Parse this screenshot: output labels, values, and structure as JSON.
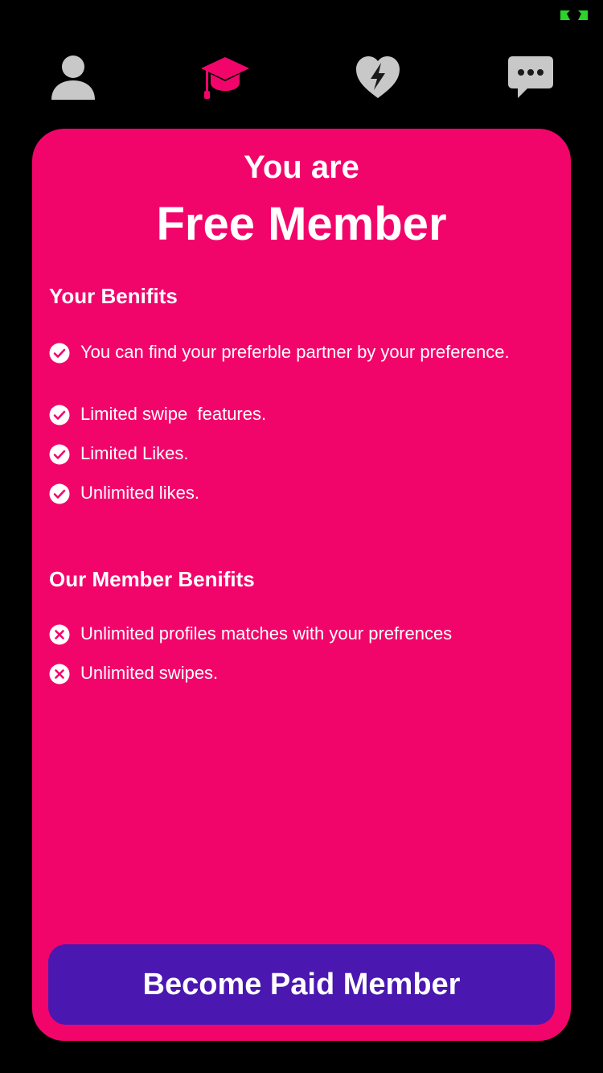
{
  "colors": {
    "background": "#000000",
    "card": "#f2056b",
    "cta": "#4a17b0",
    "tab_active": "#f2056b",
    "tab_inactive": "#c8c8c8",
    "status_indicator": "#2bd42b"
  },
  "tabs": [
    {
      "icon": "person-icon",
      "active": false
    },
    {
      "icon": "graduation-cap-icon",
      "active": true
    },
    {
      "icon": "heart-bolt-icon",
      "active": false
    },
    {
      "icon": "chat-bubble-icon",
      "active": false
    }
  ],
  "membership": {
    "intro": "You are",
    "status": "Free Member"
  },
  "your_benefits": {
    "title": "Your Benifits",
    "items": [
      {
        "text": "You can find your preferble partner by your preference.",
        "icon": "check-circle-icon"
      },
      {
        "text": "Limited swipe  features.",
        "icon": "check-circle-icon"
      },
      {
        "text": "Limited Likes.",
        "icon": "check-circle-icon"
      },
      {
        "text": "Unlimited likes.",
        "icon": "check-circle-icon"
      }
    ]
  },
  "member_benefits": {
    "title": "Our Member Benifits",
    "items": [
      {
        "text": "Unlimited profiles matches with your prefrences",
        "icon": "x-circle-icon"
      },
      {
        "text": "Unlimited swipes.",
        "icon": "x-circle-icon"
      }
    ]
  },
  "cta": {
    "label": "Become Paid Member"
  }
}
